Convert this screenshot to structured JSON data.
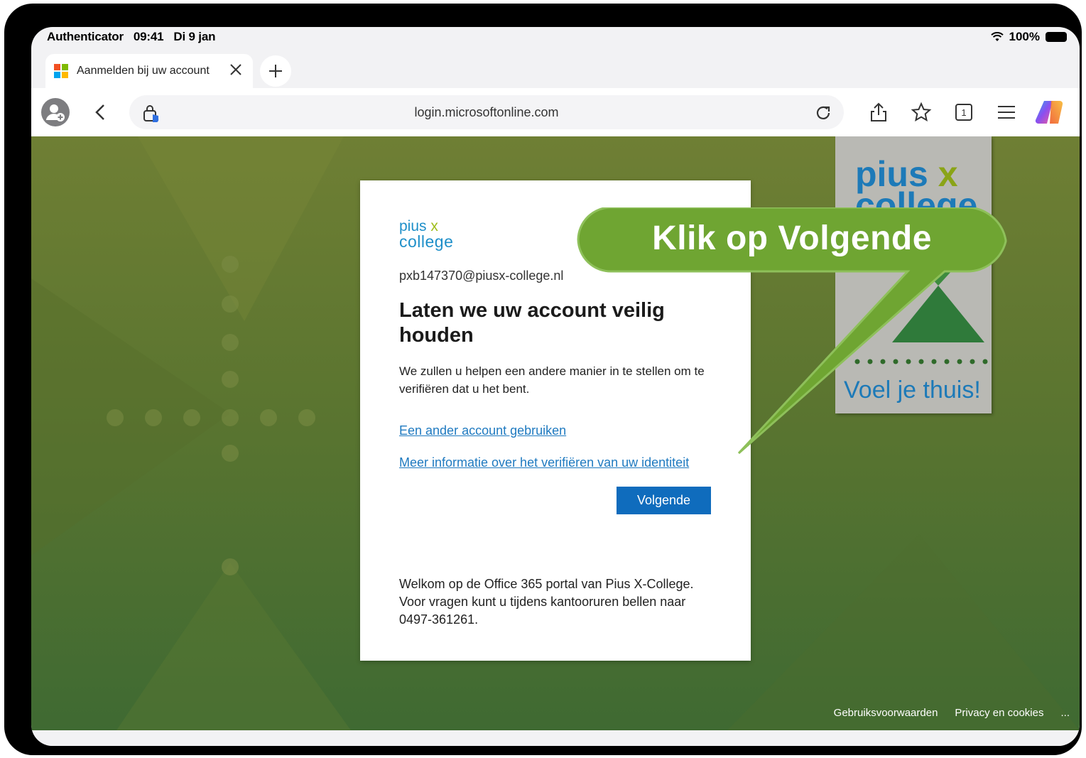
{
  "status_bar": {
    "app": "Authenticator",
    "time": "09:41",
    "date": "Di 9 jan",
    "battery": "100%"
  },
  "tab": {
    "title": "Aanmelden bij uw account",
    "logo_colors": [
      "#f25022",
      "#7fba00",
      "#00a4ef",
      "#ffb900"
    ]
  },
  "toolbar": {
    "url": "login.microsoftonline.com",
    "icons": [
      "profile-icon",
      "back-icon",
      "lock-icon",
      "reload-icon",
      "share-icon",
      "favorite-icon",
      "tabs-icon",
      "menu-icon",
      "copilot-icon"
    ],
    "tab_count": "1"
  },
  "banner": {
    "brand_line1": "pius",
    "brand_x": "x",
    "brand_line2": "college",
    "motto": "Voel je thuis!"
  },
  "card": {
    "logo_line1": "pius",
    "logo_x": "x",
    "logo_line2": "college",
    "email": "pxb147370@piusx-college.nl",
    "heading": "Laten we uw account veilig houden",
    "description": "We zullen u helpen een andere manier in te stellen om te verifiëren dat u het bent.",
    "link_other_account": "Een ander account gebruiken",
    "link_more_info": "Meer informatie over het verifiëren van uw identiteit",
    "next_button": "Volgende",
    "welcome": "Welkom op de Office 365 portal van Pius X-College. Voor vragen kunt u tijdens kantooruren bellen naar 0497-361261."
  },
  "callout": {
    "text": "Klik op Volgende",
    "color": "#6fa532"
  },
  "footer": {
    "terms": "Gebruiksvoorwaarden",
    "privacy": "Privacy en cookies",
    "more": "..."
  },
  "colors": {
    "link": "#1f7ac0",
    "primary_button": "#0f6cbd",
    "brand_blue": "#1d7ab8",
    "brand_green": "#8aa417"
  }
}
